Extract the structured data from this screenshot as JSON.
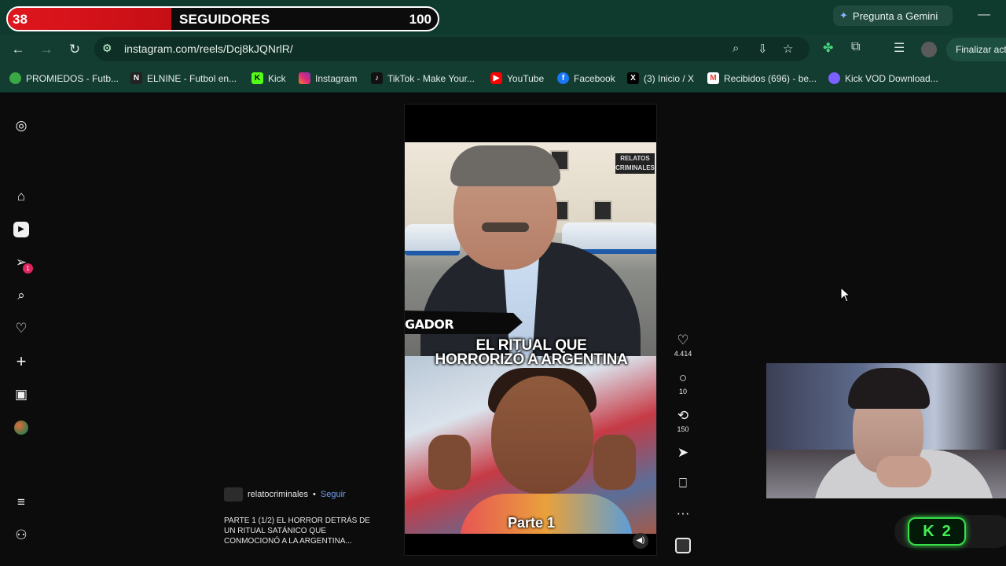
{
  "stream_overlay": {
    "followers_current": "38",
    "followers_label": "SEGUIDORES",
    "followers_goal": "100",
    "followers_progress_pct": 38,
    "kick_badge_count": "2"
  },
  "browser": {
    "gemini_label": "Pregunta a Gemini",
    "url": "instagram.com/reels/Dcj8kJQNrlR/",
    "finalizar_label": "Finalizar act",
    "bookmarks": [
      {
        "label": "PROMIEDOS - Futb...",
        "color": "#3aa845"
      },
      {
        "label": "ELNINE - Futbol en...",
        "color": "#222222"
      },
      {
        "label": "Kick",
        "color": "#53fc18"
      },
      {
        "label": "Instagram",
        "color": "#d62976"
      },
      {
        "label": "TikTok - Make Your...",
        "color": "#111111"
      },
      {
        "label": "YouTube",
        "color": "#ff0000"
      },
      {
        "label": "Facebook",
        "color": "#1877f2"
      },
      {
        "label": "(3) Inicio / X",
        "color": "#000000"
      },
      {
        "label": "Recibidos (696) - be...",
        "color": "#ea4335"
      },
      {
        "label": "Kick VOD Download...",
        "color": "#7b61ff"
      }
    ]
  },
  "instagram": {
    "reel": {
      "logo_text": "RELATOS CRIMINALES",
      "brush_text": "GADOR",
      "headline_line1": "EL RITUAL QUE",
      "headline_line2": "HORRORIZÓ A ARGENTINA",
      "part_label": "Parte 1"
    },
    "actions": {
      "likes": "4.414",
      "comments": "10",
      "reposts": "150"
    },
    "owner": {
      "username": "relatocriminales",
      "separator": "•",
      "follow_label": "Seguir"
    },
    "caption": "PARTE 1 (1/2) EL HORROR DETRÁS DE UN RITUAL SATÁNICO QUE CONMOCIONÓ A LA ARGENTINA...",
    "notification_count": "1"
  }
}
